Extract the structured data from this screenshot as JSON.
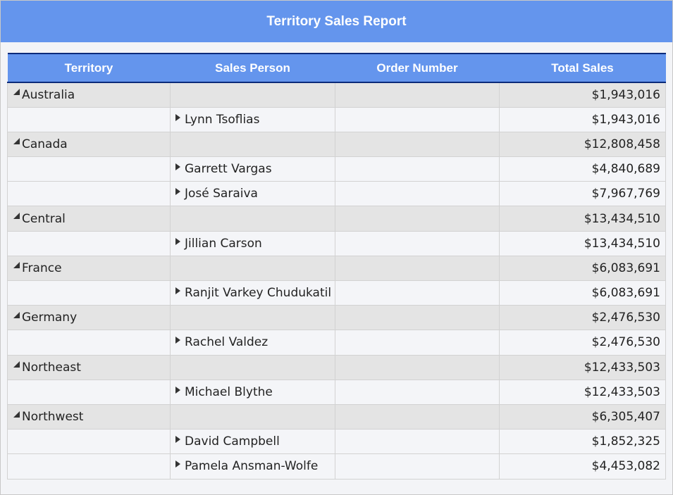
{
  "report": {
    "title": "Territory Sales Report",
    "colors": {
      "header": "#6495ed",
      "group_row": "#e4e4e4",
      "detail_row": "#f4f5f8"
    }
  },
  "columns": [
    "Territory",
    "Sales Person",
    "Order Number",
    "Total Sales"
  ],
  "rows": [
    {
      "type": "group",
      "territory": "Australia",
      "total": "$1,943,016"
    },
    {
      "type": "detail",
      "person": "Lynn Tsoflias",
      "total": "$1,943,016"
    },
    {
      "type": "group",
      "territory": "Canada",
      "total": "$12,808,458"
    },
    {
      "type": "detail",
      "person": "Garrett Vargas",
      "total": "$4,840,689"
    },
    {
      "type": "detail",
      "person": "José Saraiva",
      "total": "$7,967,769"
    },
    {
      "type": "group",
      "territory": "Central",
      "total": "$13,434,510"
    },
    {
      "type": "detail",
      "person": "Jillian Carson",
      "total": "$13,434,510"
    },
    {
      "type": "group",
      "territory": "France",
      "total": "$6,083,691"
    },
    {
      "type": "detail",
      "person": "Ranjit Varkey Chudukatil",
      "total": "$6,083,691"
    },
    {
      "type": "group",
      "territory": "Germany",
      "total": "$2,476,530"
    },
    {
      "type": "detail",
      "person": "Rachel Valdez",
      "total": "$2,476,530"
    },
    {
      "type": "group",
      "territory": "Northeast",
      "total": "$12,433,503"
    },
    {
      "type": "detail",
      "person": "Michael Blythe",
      "total": "$12,433,503"
    },
    {
      "type": "group",
      "territory": "Northwest",
      "total": "$6,305,407"
    },
    {
      "type": "detail",
      "person": "David Campbell",
      "total": "$1,852,325"
    },
    {
      "type": "detail",
      "person": "Pamela Ansman-Wolfe",
      "total": "$4,453,082"
    }
  ]
}
